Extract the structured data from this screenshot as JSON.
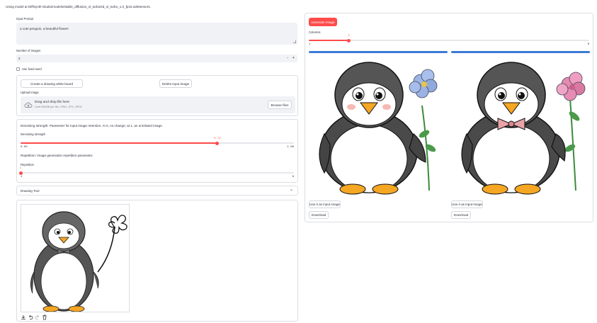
{
  "status": {
    "message": "Using model at DiffSynth-Studio/models/stable_diffusion_xl_turbo/sd_xl_turbo_1.0_fp16.safetensors."
  },
  "prompt": {
    "label": "Input Prompt",
    "value": "a cute penguin, a beautiful flower!"
  },
  "num_images": {
    "label": "Number of images",
    "value": "2",
    "minus": "-",
    "plus": "+"
  },
  "fixed_seed": {
    "label": "Use fixed seed"
  },
  "board": {
    "create_label": "Create a drawing white board",
    "delete_label": "Delete input image",
    "upload_label": "Upload image",
    "drop_title": "Drag and drop file here",
    "drop_hint": "Limit 200MB per file • PNG, JPG, JPEG",
    "browse_label": "Browse files"
  },
  "denoising": {
    "description": "Denoising strength: Parameter for input image retention. At 0, no change; at 1, an unrelated image.",
    "label": "Denoising strength",
    "value_text": "0.72",
    "value": 0.72,
    "min": "0.00",
    "max": "1.00"
  },
  "repetition": {
    "description": "Repetition: Image generation repetition parameter.",
    "label": "Repetition",
    "value_text": "1",
    "value": 1,
    "min_num": 1,
    "max_num": 8,
    "min": "1",
    "max": "8"
  },
  "drawing_tool": {
    "label": "Drawing Tool",
    "chevron": "⌄"
  },
  "canvas_tools": [
    "download-icon",
    "undo-icon",
    "redo-icon",
    "trash-icon"
  ],
  "generate": {
    "label": "Generate Image"
  },
  "columns": {
    "label": "Columns",
    "value_text": "2",
    "value": 2,
    "min_num": 1,
    "max_num": 8,
    "min": "1",
    "max": "8"
  },
  "results": [
    {
      "use_label": "Use it as input image",
      "download_label": "Download"
    },
    {
      "use_label": "Use it as input image",
      "download_label": "Download"
    }
  ],
  "colors": {
    "accent": "#ff4b4b",
    "result_bar": "#3a7bd5",
    "input_bg": "#f0f2f6"
  }
}
